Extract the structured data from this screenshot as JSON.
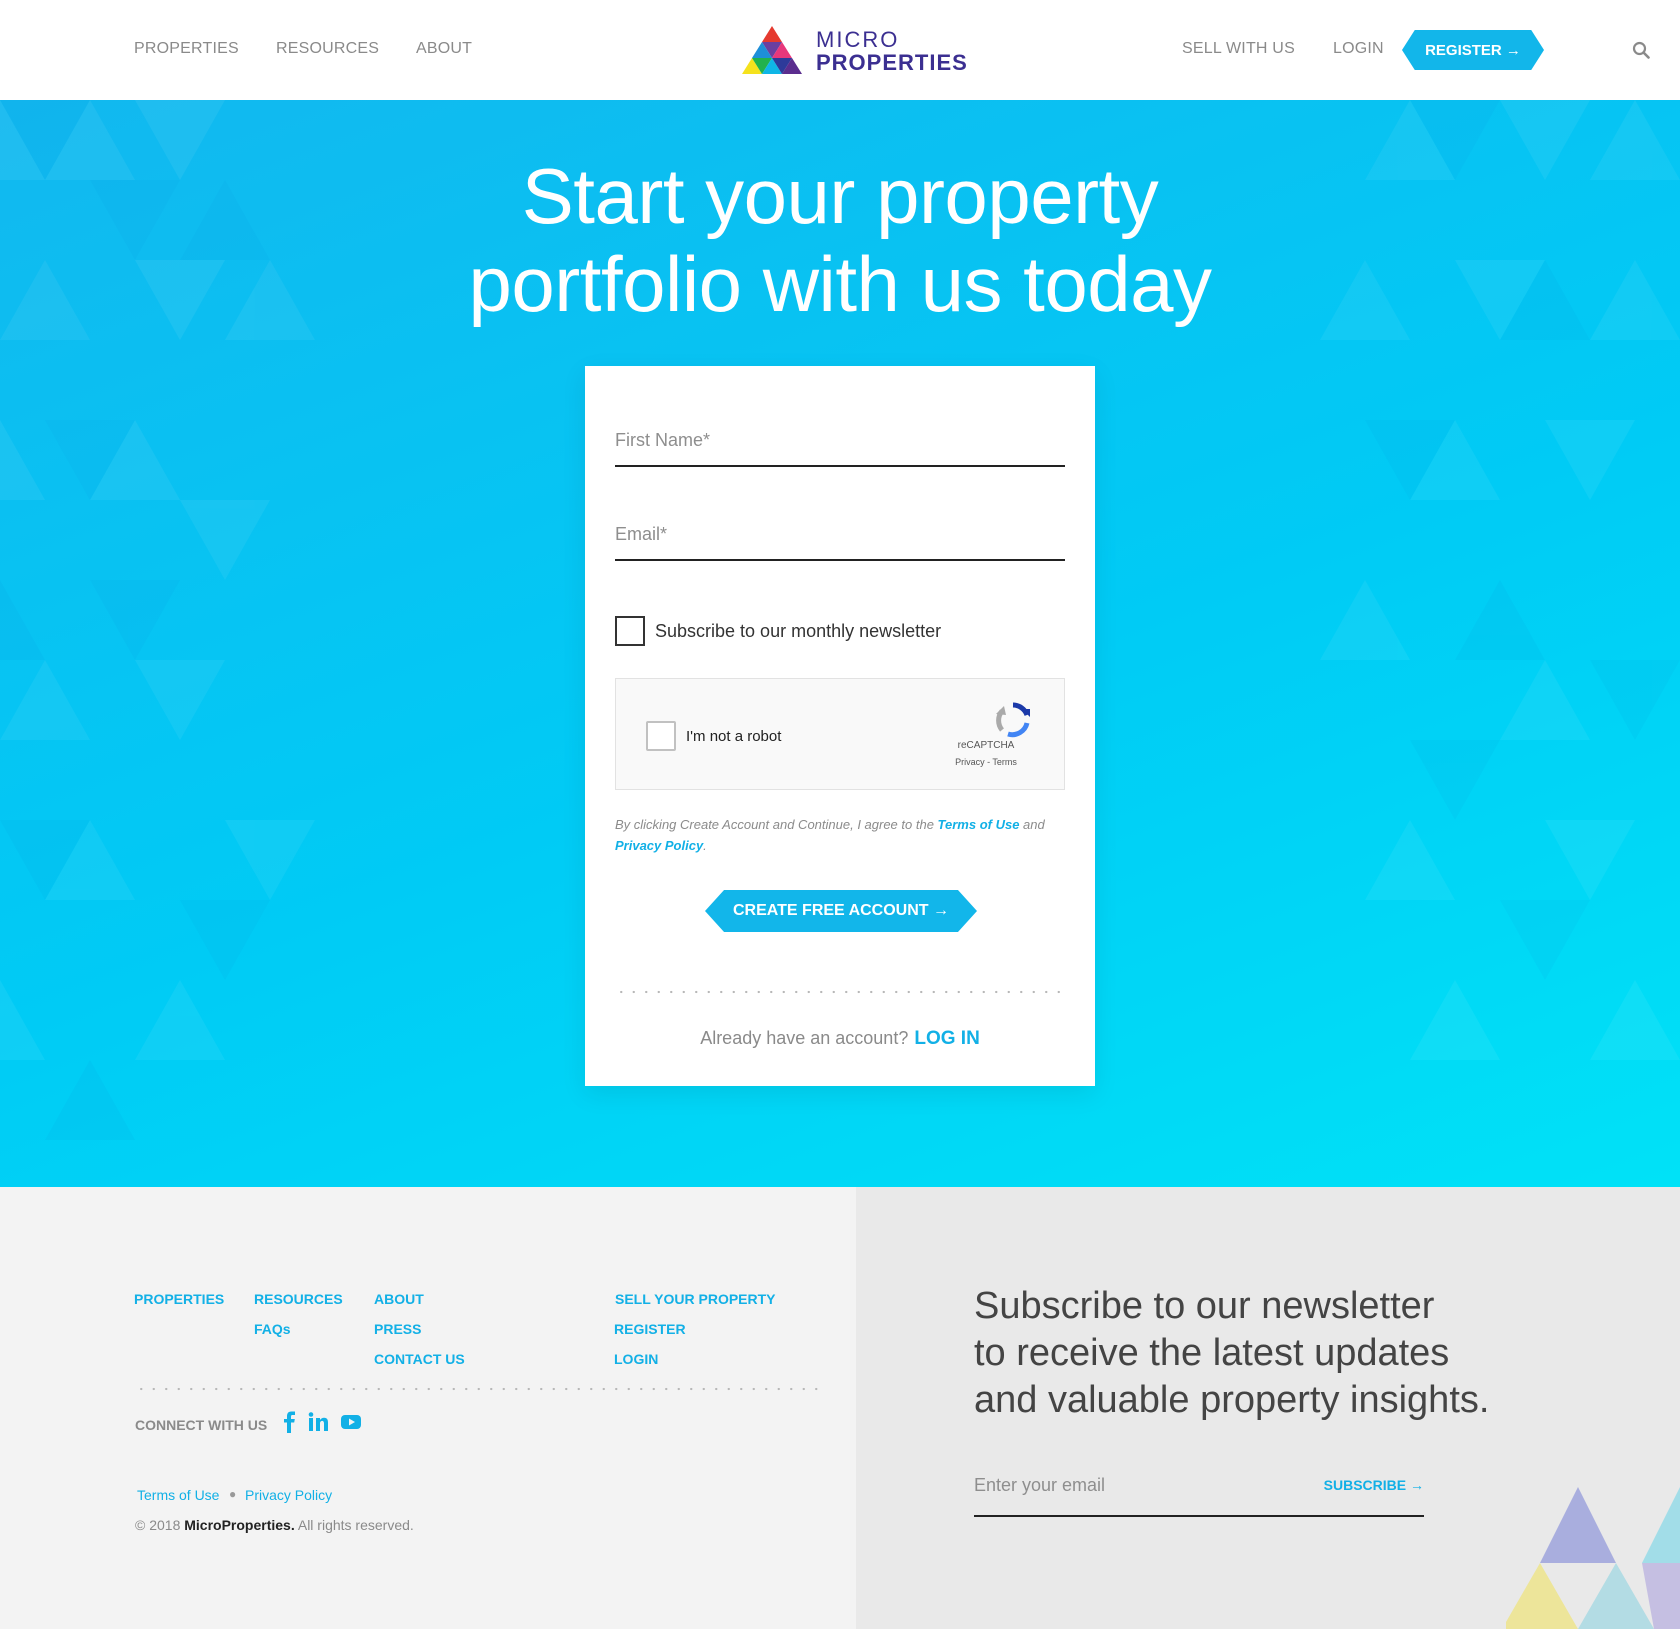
{
  "header": {
    "nav_left": [
      "PROPERTIES",
      "RESOURCES",
      "ABOUT"
    ],
    "logo_line1": "MICRO",
    "logo_line2": "PROPERTIES",
    "nav_right": [
      "SELL WITH US",
      "LOGIN"
    ],
    "register_label": "REGISTER →"
  },
  "hero": {
    "title_line1": "Start your property",
    "title_line2": "portfolio with us today"
  },
  "form": {
    "first_name_placeholder": "First Name*",
    "email_placeholder": "Email*",
    "newsletter_label": "Subscribe to our monthly newsletter",
    "captcha": {
      "label": "I'm not a robot",
      "brand": "reCAPTCHA",
      "links": "Privacy - Terms"
    },
    "terms_prefix": "By clicking Create Account and Continue, I agree to the ",
    "terms_link": "Terms of Use",
    "terms_middle": " and ",
    "privacy_link": "Privacy Policy",
    "terms_suffix": ".",
    "submit_label": "CREATE FREE ACCOUNT →",
    "login_prompt": "Already have an account?",
    "login_link": "LOG IN"
  },
  "footer": {
    "col1": [
      "PROPERTIES"
    ],
    "col2": [
      "RESOURCES",
      "FAQs"
    ],
    "col3": [
      "ABOUT",
      "PRESS",
      "CONTACT US"
    ],
    "col4": [
      "SELL YOUR PROPERTY",
      "REGISTER",
      "LOGIN"
    ],
    "connect_label": "CONNECT WITH US",
    "social_icons": [
      "facebook-icon",
      "linkedin-icon",
      "youtube-icon"
    ],
    "terms_link": "Terms of Use",
    "privacy_link": "Privacy Policy",
    "copyright_prefix": "© 2018 ",
    "copyright_brand": "MicroProperties.",
    "copyright_suffix": " All rights reserved.",
    "newsletter_title_line1": "Subscribe to our newsletter",
    "newsletter_title_line2": "to receive the latest updates",
    "newsletter_title_line3": "and valuable property insights.",
    "newsletter_placeholder": "Enter your email",
    "subscribe_label": "SUBSCRIBE →"
  },
  "colors": {
    "accent": "#12b6ea",
    "hero_gradient_start": "#12b8ef",
    "hero_gradient_end": "#00e2f7",
    "logo_text": "#3b2f91"
  }
}
